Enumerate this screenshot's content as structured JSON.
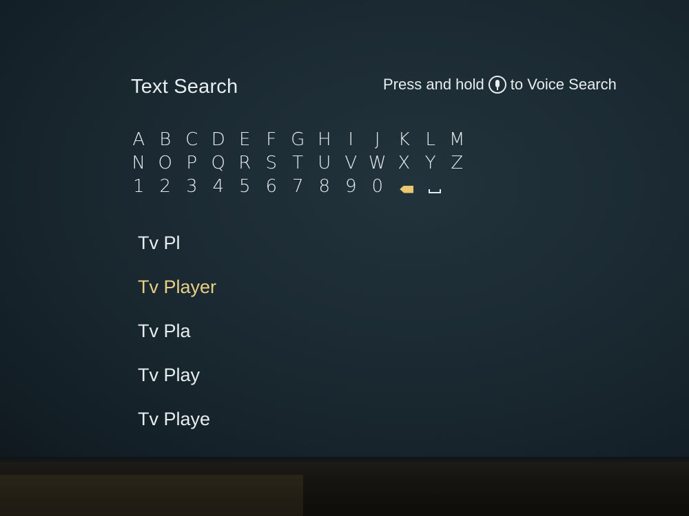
{
  "header": {
    "title": "Text Search",
    "voice_prefix": "Press and hold",
    "voice_icon": "mic-icon",
    "voice_suffix": "to Voice Search"
  },
  "keyboard": {
    "row1": [
      "A",
      "B",
      "C",
      "D",
      "E",
      "F",
      "G",
      "H",
      "I",
      "J",
      "K",
      "L",
      "M"
    ],
    "row2": [
      "N",
      "O",
      "P",
      "Q",
      "R",
      "S",
      "T",
      "U",
      "V",
      "W",
      "X",
      "Y",
      "Z"
    ],
    "row3": [
      "1",
      "2",
      "3",
      "4",
      "5",
      "6",
      "7",
      "8",
      "9",
      "0"
    ],
    "backspace_icon": "backspace-icon",
    "space_icon": "space-icon",
    "focused_key": "backspace",
    "focus_color": "#e8c873"
  },
  "suggestions": {
    "items": [
      "Tv Pl",
      "Tv Player",
      "Tv Pla",
      "Tv Play",
      "Tv Playe"
    ],
    "selected_index": 1,
    "selected_color": "#e9cf86"
  }
}
